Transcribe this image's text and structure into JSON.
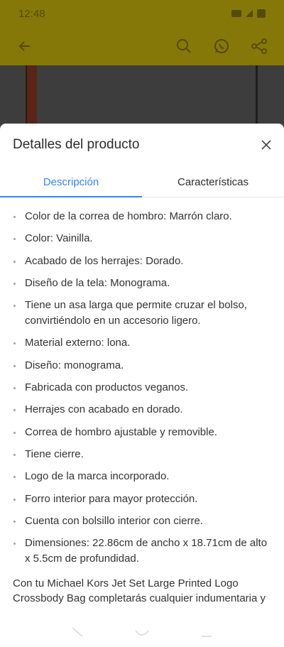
{
  "status_bar": {
    "time": "12:48"
  },
  "sheet": {
    "title": "Detalles del producto",
    "close_label": "×"
  },
  "tabs": [
    {
      "label": "Descripción",
      "active": true
    },
    {
      "label": "Características",
      "active": false
    }
  ],
  "description": {
    "bullets": [
      "Color de la correa de hombro: Marrón claro.",
      "Color: Vainilla.",
      "Acabado de los herrajes: Dorado.",
      "Diseño de la tela: Monograma.",
      "Tiene un asa larga que permite cruzar el bolso, convirtiéndolo en un accesorio ligero.",
      "Material externo: lona.",
      "Diseño: monograma.",
      "Fabricada con productos veganos.",
      "Herrajes con acabado en dorado.",
      "Correa de hombro ajustable y removible.",
      "Tiene cierre.",
      "Logo de la marca incorporado.",
      "Forro interior para mayor protección.",
      "Cuenta con bolsillo interior con cierre.",
      "Dimensiones: 22.86cm de ancho x 18.71cm de alto x 5.5cm de profundidad."
    ],
    "paragraph": "Con tu Michael Kors Jet Set Large Printed Logo Crossbody Bag completarás cualquier indumentaria y"
  },
  "colors": {
    "accent": "#3483fa",
    "overlay_toolbar": "#857808",
    "text": "#333333"
  },
  "icons": [
    "back-arrow-icon",
    "search-icon",
    "whatsapp-icon",
    "share-icon",
    "close-icon"
  ]
}
